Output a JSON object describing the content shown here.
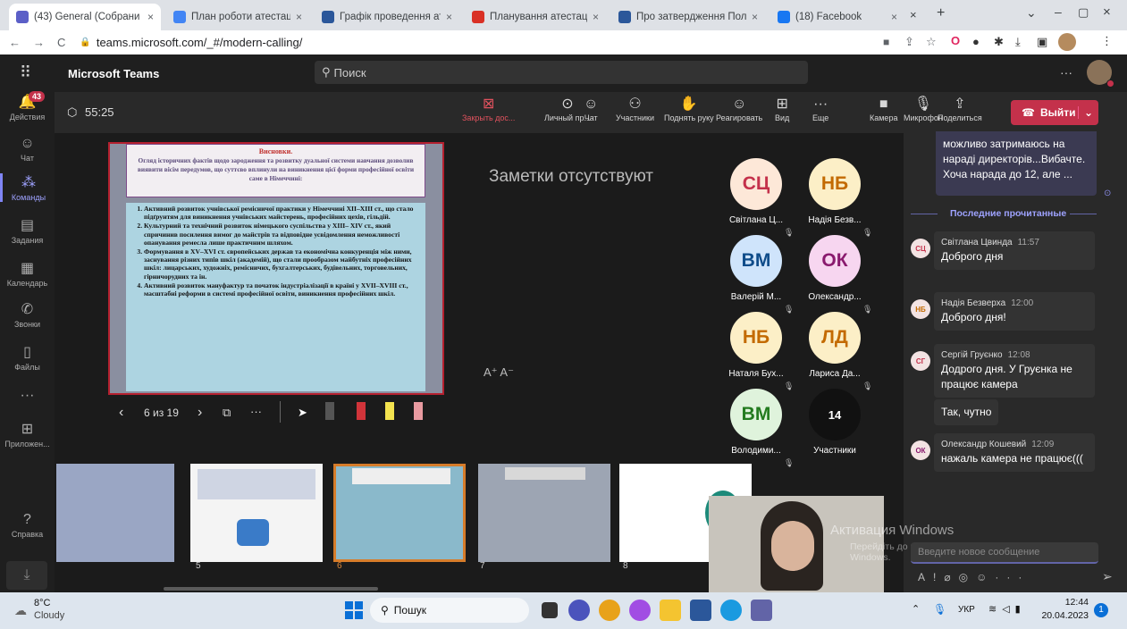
{
  "browser": {
    "tabs": [
      {
        "label": "(43) General (Собрани",
        "active": true,
        "color": "#5b5fc7"
      },
      {
        "label": "План роботи атестаційної",
        "color": "#4285f4"
      },
      {
        "label": "Графік проведення атеста",
        "color": "#2b579a"
      },
      {
        "label": "Планування атестації педа",
        "color": "#d93025"
      },
      {
        "label": "Про затвердження Полож",
        "color": "#2b579a"
      },
      {
        "label": "(18) Facebook",
        "color": "#1877f2"
      }
    ],
    "url": "teams.microsoft.com/_#/modern-calling/"
  },
  "teams": {
    "app_name": "Microsoft Teams",
    "search_placeholder": "Поиск",
    "rail": [
      {
        "label": "Действия",
        "icon": "bell-icon",
        "badge": "43"
      },
      {
        "label": "Чат",
        "icon": "chat-icon"
      },
      {
        "label": "Команды",
        "icon": "teams-icon",
        "active": true
      },
      {
        "label": "Задания",
        "icon": "assignments-icon"
      },
      {
        "label": "Календарь",
        "icon": "calendar-icon"
      },
      {
        "label": "Звонки",
        "icon": "phone-icon"
      },
      {
        "label": "Файлы",
        "icon": "file-icon"
      },
      {
        "label": "...",
        "icon": "more-icon"
      },
      {
        "label": "Приложен...",
        "icon": "apps-icon"
      }
    ],
    "help_label": "Справка"
  },
  "call": {
    "timer": "55:25",
    "buttons": [
      {
        "label": "Закрыть дос...",
        "icon": "close-share-icon"
      },
      {
        "label": "Личный пр...",
        "icon": "eye-icon"
      },
      {
        "label": "Чат",
        "icon": "chat-icon"
      },
      {
        "label": "Участники",
        "icon": "people-icon"
      },
      {
        "label": "Поднять руку",
        "icon": "hand-icon"
      },
      {
        "label": "Реагировать",
        "icon": "smile-icon"
      },
      {
        "label": "Вид",
        "icon": "grid-icon"
      },
      {
        "label": "Еще",
        "icon": "more-icon"
      },
      {
        "label": "Камера",
        "icon": "camera-icon"
      },
      {
        "label": "Микрофон",
        "icon": "mic-icon"
      },
      {
        "label": "Поделиться",
        "icon": "share-icon"
      }
    ],
    "leave_label": "Выйти"
  },
  "slide": {
    "title": "Висновки.",
    "subtitle": "Огляд історичних фактів щодо зародження та розвитку дуальної системи навчання дозволив виявити вісім передумов, що суттєво вплинули на виникнення цієї форми професійної освіти саме в Німеччині:",
    "points": [
      "Активний розвиток учнівської ремісничої практики у Німеччині XII–XIII ст., що стало підґрунтям для виникнення учнівських майстерень, професійних цехів, гільдій.",
      "Культурний та технічний розвиток німецького суспільства у XIII– XIV ст., який спричинив посилення вимог до майстрів та відповідне усвідомлення неможливості опанування ремесла лише практичним шляхом.",
      "Формування в XV–XVI ст. європейських держав та економічна конкуренція між ними, заснування різних типів шкіл (академій), що стали прообразом майбутніх професійних шкіл: лицарських, художніх, ремісничих, бухгалтерських, будівельних, торговельних, гірничорудних та ін.",
      "Активний розвиток мануфактур та початок індустріалізації в країні у XVII–XVIII ст., масштабні реформи в системі професійної освіти, виникнення професійних шкіл."
    ],
    "nav": "6 из 19",
    "notes": "Заметки отсутствуют",
    "font_controls": "A⁺ A⁻",
    "thumb_numbers": [
      "5",
      "6",
      "7",
      "8"
    ]
  },
  "participants": [
    {
      "initials": "СЦ",
      "name": "Світлана Ц...",
      "bg": "#fde8d8",
      "fg": "#c4314b"
    },
    {
      "initials": "НБ",
      "name": "Надія Безв...",
      "bg": "#fcefc7",
      "fg": "#c36a00"
    },
    {
      "initials": "ВМ",
      "name": "Валерій М...",
      "bg": "#cfe4fb",
      "fg": "#0f4c8a"
    },
    {
      "initials": "ОК",
      "name": "Олександр...",
      "bg": "#f7d6f0",
      "fg": "#8a1a6e"
    },
    {
      "initials": "НБ",
      "name": "Наталя Бух...",
      "bg": "#fcefc7",
      "fg": "#c36a00"
    },
    {
      "initials": "ЛД",
      "name": "Лариса Да...",
      "bg": "#fcefc7",
      "fg": "#c36a00"
    },
    {
      "initials": "ВМ",
      "name": "Володими...",
      "bg": "#dff3dc",
      "fg": "#237b1f"
    },
    {
      "initials": "14",
      "name": "Участники",
      "bg": "#111111",
      "fg": "#ffffff"
    }
  ],
  "chat": {
    "top_bubble": "можливо затримаюсь на нараді директорів...Вибачте. Хоча нарада до 12, але ...",
    "divider": "Последние прочитанные",
    "messages": [
      {
        "initials": "СЦ",
        "author": "Світлана Цвинда",
        "time": "11:57",
        "text": "Доброго дня",
        "color": "#c4314b"
      },
      {
        "initials": "НБ",
        "author": "Надія Безверха",
        "time": "12:00",
        "text": "Доброго дня!",
        "color": "#c36a00"
      },
      {
        "initials": "СГ",
        "author": "Сергій Груєнко",
        "time": "12:08",
        "text": "Додрого дня. У Груєнка не працює камера",
        "color": "#c4314b"
      },
      {
        "initials": "",
        "author": "",
        "time": "",
        "text": "Так, чутно",
        "color": ""
      },
      {
        "initials": "ОК",
        "author": "Олександр Кошевий",
        "time": "12:09",
        "text": "нажаль камера не працює(((",
        "color": "#8a1a6e"
      }
    ],
    "compose_placeholder": "Введите новое сообщение",
    "watermark_title": "Активация Windows",
    "watermark_sub": "Перейдіть до розділу \"Настройки\", щоб активувати Windows."
  },
  "taskbar": {
    "weather_temp": "8°C",
    "weather_desc": "Cloudy",
    "search": "Пошук",
    "lang": "УКР",
    "time": "12:44",
    "date": "20.04.2023"
  }
}
